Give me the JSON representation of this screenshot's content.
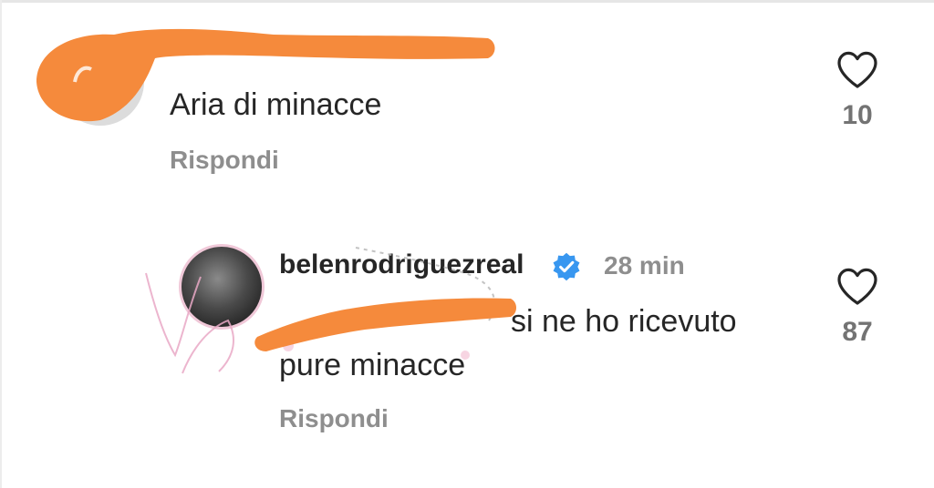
{
  "comments": [
    {
      "username": "",
      "time": "",
      "text": "Aria di minacce",
      "reply_label": "Rispondi",
      "likes": "10"
    },
    {
      "username": "belenrodriguezreal",
      "verified": true,
      "time": "28 min",
      "text_line1": "si ne ho ricevuto",
      "text_line2": "pure minacce",
      "reply_label": "Rispondi",
      "likes": "87"
    }
  ],
  "colors": {
    "text": "#262626",
    "secondary": "#8e8e8e",
    "verified": "#3897f0",
    "redaction": "#f58a3c"
  },
  "icons": [
    "heart-icon",
    "verified-badge-icon"
  ]
}
